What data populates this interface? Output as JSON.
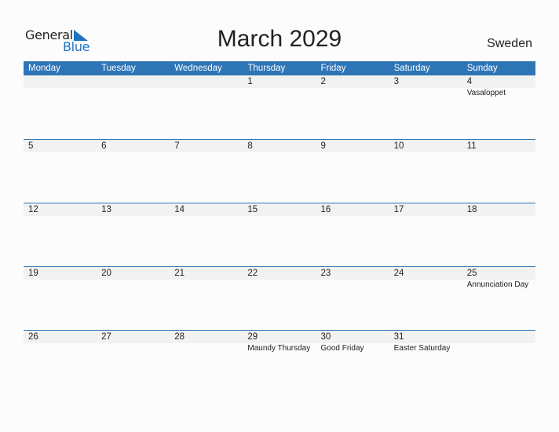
{
  "logo": {
    "general": "General",
    "blue": "Blue"
  },
  "title": "March 2029",
  "country": "Sweden",
  "weekdays": [
    "Monday",
    "Tuesday",
    "Wednesday",
    "Thursday",
    "Friday",
    "Saturday",
    "Sunday"
  ],
  "weeks": [
    {
      "days": [
        "",
        "",
        "",
        "1",
        "2",
        "3",
        "4"
      ],
      "holidays": [
        "",
        "",
        "",
        "",
        "",
        "",
        "Vasaloppet"
      ]
    },
    {
      "days": [
        "5",
        "6",
        "7",
        "8",
        "9",
        "10",
        "11"
      ],
      "holidays": [
        "",
        "",
        "",
        "",
        "",
        "",
        ""
      ]
    },
    {
      "days": [
        "12",
        "13",
        "14",
        "15",
        "16",
        "17",
        "18"
      ],
      "holidays": [
        "",
        "",
        "",
        "",
        "",
        "",
        ""
      ]
    },
    {
      "days": [
        "19",
        "20",
        "21",
        "22",
        "23",
        "24",
        "25"
      ],
      "holidays": [
        "",
        "",
        "",
        "",
        "",
        "",
        "Annunciation Day"
      ]
    },
    {
      "days": [
        "26",
        "27",
        "28",
        "29",
        "30",
        "31",
        ""
      ],
      "holidays": [
        "",
        "",
        "",
        "Maundy Thursday",
        "Good Friday",
        "Easter Saturday",
        ""
      ]
    }
  ],
  "colors": {
    "accent": "#2e75b6",
    "logo_blue": "#1e73be",
    "day_row_bg": "#f2f2f2"
  }
}
